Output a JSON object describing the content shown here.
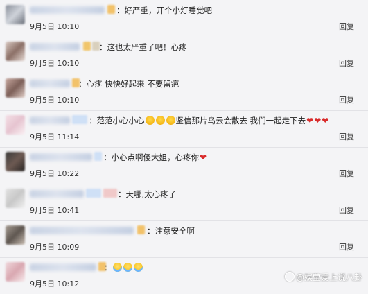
{
  "comments": [
    {
      "text": "：好严重，开个小灯睡觉吧",
      "time": "9月5日 10:10",
      "reply": "回复"
    },
    {
      "text": "：这也太严重了吧！心疼",
      "time": "9月5日 10:10",
      "reply": "回复"
    },
    {
      "text": "：心疼 快快好起来 不要留疤",
      "time": "9月5日 10:10",
      "reply": "回复"
    },
    {
      "text_before": "：范范小心小心",
      "text_after": "坚信那片乌云会散去 我们一起走下去",
      "emoji_count": 3,
      "hearts": 3,
      "time": "9月5日 11:14",
      "reply": "回复"
    },
    {
      "text": "：小心点啊傻大姐，心疼你",
      "hearts": 1,
      "time": "9月5日 10:22",
      "reply": "回复"
    },
    {
      "text": "：天哪,太心疼了",
      "time": "9月5日 10:41",
      "reply": "回复"
    },
    {
      "text": "：注意安全啊",
      "time": "9月5日 10:09",
      "reply": "回复"
    },
    {
      "text": "：",
      "emoji_count": 3,
      "time": "9月5日 10:12",
      "reply": "回复"
    }
  ],
  "watermark": "@娱莹爱上说八卦",
  "colors": {
    "background": "#f4f4f6",
    "divider": "#e2e2e6",
    "heart": "#d92b2b"
  }
}
